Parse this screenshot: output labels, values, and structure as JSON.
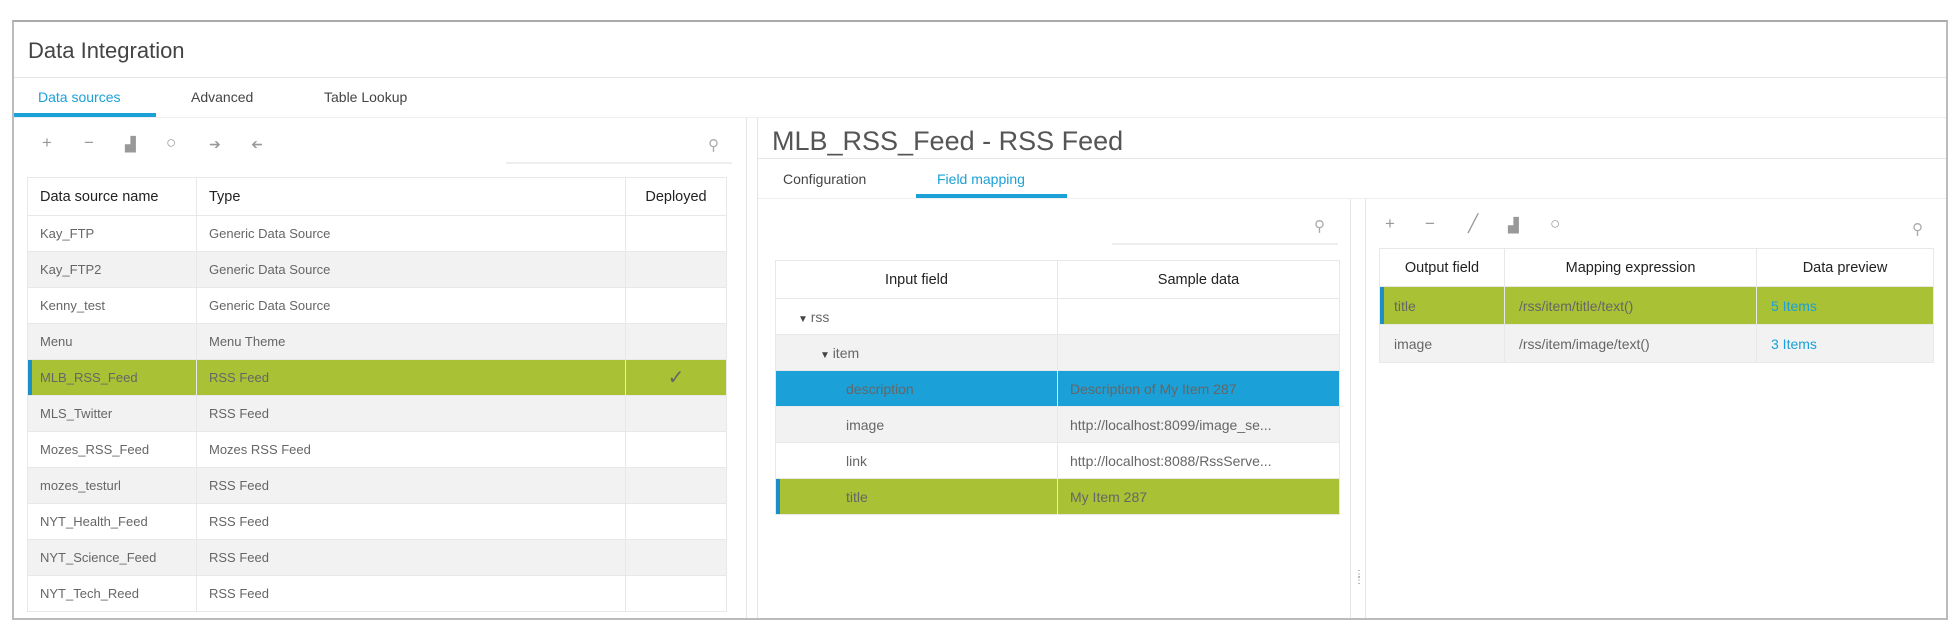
{
  "app": {
    "title": "Data Integration"
  },
  "tabs": [
    {
      "label": "Data sources",
      "active": true
    },
    {
      "label": "Advanced"
    },
    {
      "label": "Table Lookup"
    }
  ],
  "left_toolbar": {
    "icons": [
      "plus-icon",
      "minus-icon",
      "copy-icon",
      "refresh-icon",
      "arrow-right-icon",
      "arrow-left-icon"
    ],
    "search_placeholder": ""
  },
  "data_sources": {
    "columns": [
      "Data source name",
      "Type",
      "Deployed"
    ],
    "rows": [
      {
        "name": "Kay_FTP",
        "type": "Generic Data Source",
        "deployed": ""
      },
      {
        "name": "Kay_FTP2",
        "type": "Generic Data Source",
        "deployed": ""
      },
      {
        "name": "Kenny_test",
        "type": "Generic Data Source",
        "deployed": ""
      },
      {
        "name": "Menu",
        "type": "Menu Theme",
        "deployed": ""
      },
      {
        "name": "MLB_RSS_Feed",
        "type": "RSS Feed",
        "deployed": "✓",
        "selected": true
      },
      {
        "name": "MLS_Twitter",
        "type": "RSS Feed",
        "deployed": ""
      },
      {
        "name": "Mozes_RSS_Feed",
        "type": "Mozes RSS Feed",
        "deployed": ""
      },
      {
        "name": "mozes_testurl",
        "type": "RSS Feed",
        "deployed": ""
      },
      {
        "name": "NYT_Health_Feed",
        "type": "RSS Feed",
        "deployed": ""
      },
      {
        "name": "NYT_Science_Feed",
        "type": "RSS Feed",
        "deployed": ""
      },
      {
        "name": "NYT_Tech_Reed",
        "type": "RSS Feed",
        "deployed": ""
      }
    ]
  },
  "detail": {
    "title": "MLB_RSS_Feed - RSS Feed",
    "tabs": [
      {
        "label": "Configuration"
      },
      {
        "label": "Field mapping",
        "active": true
      }
    ]
  },
  "input_fields": {
    "columns": [
      "Input field",
      "Sample data"
    ],
    "rows": [
      {
        "field": "rss",
        "sample": "",
        "level": 0,
        "expanded": true
      },
      {
        "field": "item",
        "sample": "",
        "level": 1,
        "expanded": true
      },
      {
        "field": "description",
        "sample": "Description of My Item 287",
        "level": 2,
        "state": "blue"
      },
      {
        "field": "image",
        "sample": "http://localhost:8099/image_se...",
        "level": 2
      },
      {
        "field": "link",
        "sample": "http://localhost:8088/RssServe...",
        "level": 2
      },
      {
        "field": "title",
        "sample": "My Item 287",
        "level": 2,
        "state": "green"
      }
    ]
  },
  "output_toolbar": {
    "icons": [
      "plus-icon",
      "minus-icon",
      "edit-icon",
      "copy-icon",
      "refresh-icon"
    ]
  },
  "output_fields": {
    "columns": [
      "Output field",
      "Mapping expression",
      "Data preview"
    ],
    "rows": [
      {
        "field": "title",
        "expr": "/rss/item/title/text()",
        "preview": "5 Items",
        "selected": true
      },
      {
        "field": "image",
        "expr": "/rss/item/image/text()",
        "preview": "3 Items"
      }
    ]
  },
  "colors": {
    "accent": "#1ba0d7",
    "selected": "#a9c135"
  }
}
